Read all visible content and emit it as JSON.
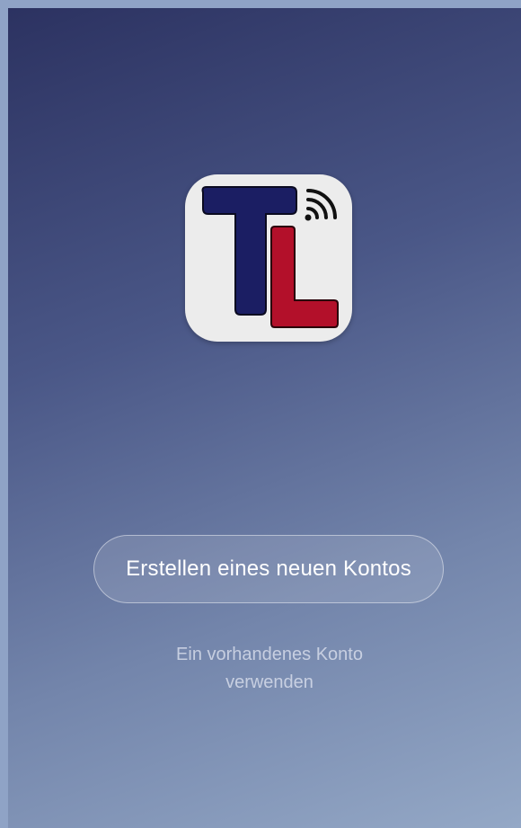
{
  "logo": {
    "letters": "TL",
    "icon": "tl-logo-wifi-icon",
    "colors": {
      "t": "#1b1e63",
      "l": "#b3102a",
      "bg": "#ececec",
      "signal": "#111111"
    }
  },
  "actions": {
    "create_account_label": "Erstellen eines neuen Kontos",
    "existing_account_label_line1": "Ein vorhandenes Konto",
    "existing_account_label_line2": "verwenden"
  }
}
